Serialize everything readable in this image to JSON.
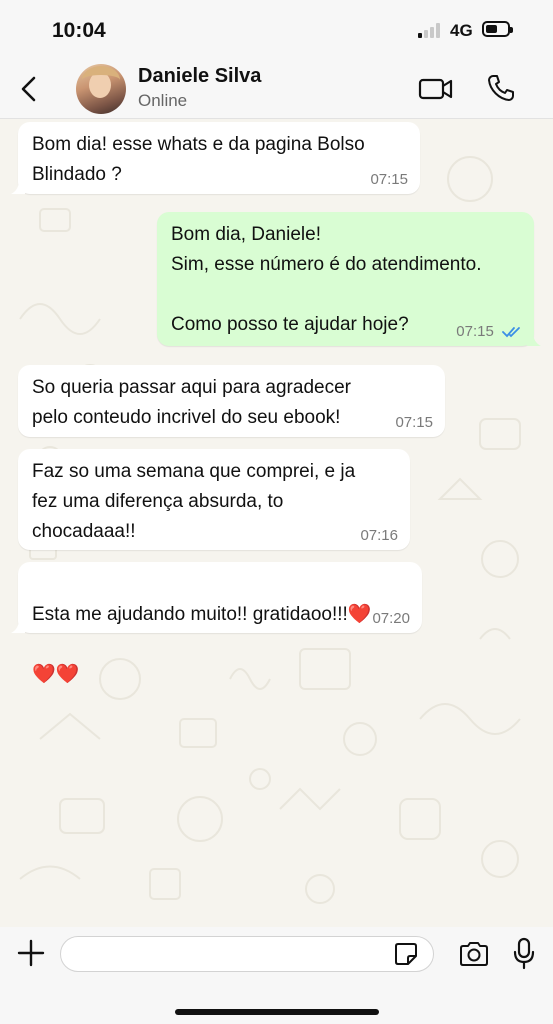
{
  "status_bar": {
    "time": "10:04",
    "network": "4G"
  },
  "header": {
    "name": "Daniele Silva",
    "status": "Online"
  },
  "messages": [
    {
      "direction": "in",
      "text": "Bom dia! esse whats e da pagina Bolso\nBlindado ?",
      "time": "07:15"
    },
    {
      "direction": "out",
      "text": "Bom dia, Daniele!\nSim, esse número é do atendimento.\n\nComo posso te ajudar hoje?",
      "time": "07:15",
      "read": true
    },
    {
      "direction": "in",
      "text": "So queria passar aqui para agradecer\npelo conteudo incrivel do seu ebook!",
      "time": "07:15"
    },
    {
      "direction": "in",
      "text": "Faz so uma semana que comprei, e ja\nfez uma diferença absurda, to\nchocadaaa!!",
      "time": "07:16"
    },
    {
      "direction": "in",
      "text": "Esta me ajudando muito!! gratidaoo!!!",
      "emoji_line1": "❤️",
      "emoji_line2": "❤️❤️",
      "time": "07:20"
    }
  ],
  "input": {
    "value": "",
    "placeholder": ""
  },
  "colors": {
    "incoming_bubble": "#ffffff",
    "outgoing_bubble": "#d9fdd3",
    "read_ticks": "#3b8fe6",
    "chat_background": "#f6f4ee"
  },
  "icons": {
    "back": "chevron-left-icon",
    "video": "video-camera-icon",
    "call": "phone-icon",
    "attach": "plus-icon",
    "sticker": "sticker-icon",
    "camera": "camera-icon",
    "mic": "microphone-icon"
  }
}
